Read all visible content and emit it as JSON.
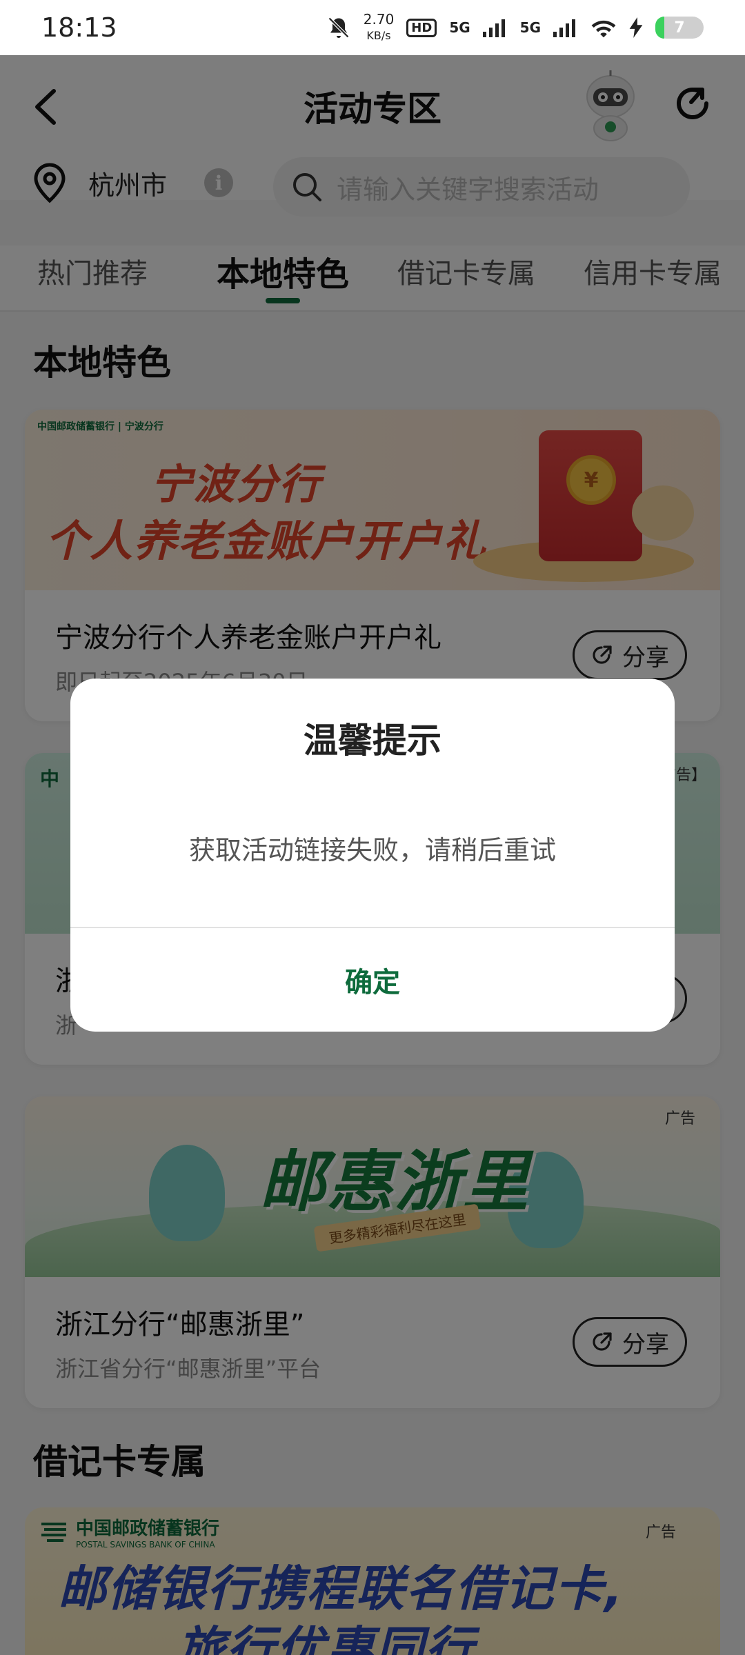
{
  "status_bar": {
    "time": "18:13",
    "net_speed_value": "2.70",
    "net_speed_unit": "KB/s",
    "hd_label": "HD",
    "sim1": "5G",
    "sim2": "5G",
    "battery": "7"
  },
  "header": {
    "title": "活动专区",
    "city": "杭州市",
    "info_icon": "i",
    "search_placeholder": "请输入关键字搜索活动"
  },
  "tabs": [
    {
      "label": "热门推荐",
      "active": false
    },
    {
      "label": "本地特色",
      "active": true
    },
    {
      "label": "借记卡专属",
      "active": false
    },
    {
      "label": "信用卡专属",
      "active": false
    }
  ],
  "sections": {
    "local": "本地特色",
    "debit": "借记卡专属"
  },
  "cards": [
    {
      "banner_logo": "中国邮政储蓄银行 | 宁波分行",
      "banner_line1": "宁波分行",
      "banner_line2": "个人养老金账户开户礼",
      "coin": "¥",
      "title": "宁波分行个人养老金账户开户礼",
      "subtitle": "即日起至2025年6月30日",
      "share": "分享"
    },
    {
      "banner_logo": "中",
      "ad": "【广告】",
      "title": "浙",
      "subtitle": "浙",
      "share": "分享"
    },
    {
      "ad": "广告",
      "banner_big": "邮惠浙里",
      "banner_ribbon": "更多精彩福利尽在这里",
      "title": "浙江分行“邮惠浙里”",
      "subtitle": "浙江省分行“邮惠浙里”平台",
      "share": "分享"
    }
  ],
  "debit_banner": {
    "logo_cn": "中国邮政储蓄银行",
    "logo_en": "POSTAL SAVINGS BANK OF CHINA",
    "ad": "广告",
    "line1": "邮储银行携程联名借记卡,",
    "line2": "旅行优惠同行"
  },
  "dialog": {
    "title": "温馨提示",
    "message": "获取活动链接失败，请稍后重试",
    "confirm": "确定"
  },
  "colors": {
    "brand_green": "#0e6b3c",
    "overlay": "rgba(0,0,0,0.5)"
  }
}
